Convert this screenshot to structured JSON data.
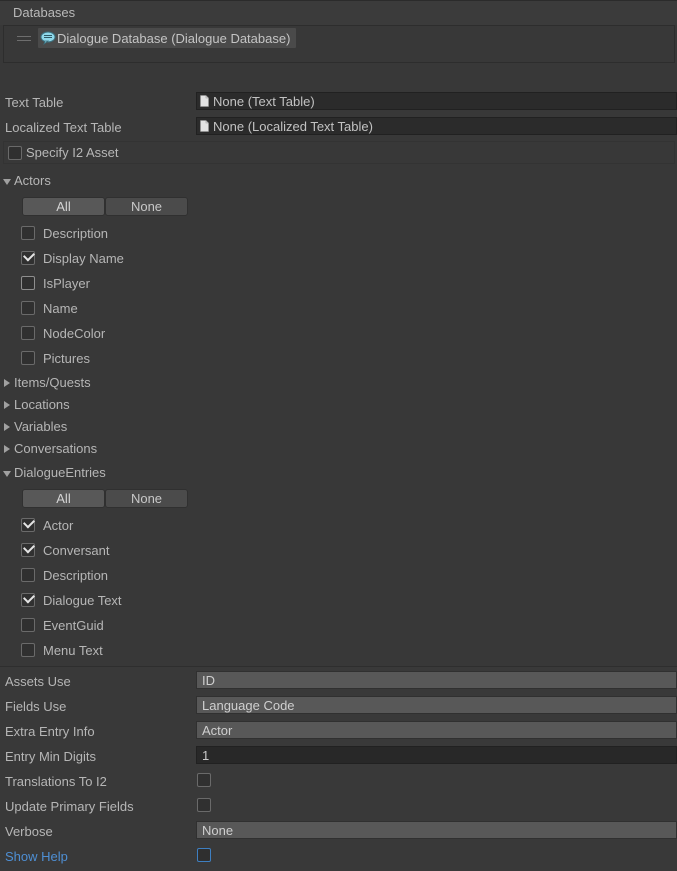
{
  "window": {
    "background": "#383838",
    "accent_blue": "#4e8fd4"
  },
  "databases_section": {
    "header_label": "Databases",
    "rows": [
      {
        "icon": "dialogue-bubble-icon",
        "label": "Dialogue Database (Dialogue Database)",
        "drag_handle": "drag-handle-icon"
      }
    ]
  },
  "text_tables": {
    "rows": [
      {
        "label": "Text Table",
        "value": "None (Text Table)",
        "icon": "document-icon"
      },
      {
        "label": "Localized Text Table",
        "value": "None (Localized Text Table)",
        "icon": "document-icon"
      }
    ],
    "specify_i2_asset": {
      "label": "Specify I2 Asset",
      "checked": false
    }
  },
  "sections": [
    {
      "name": "Actors",
      "label": "Actors",
      "expanded": true,
      "buttons": {
        "all": "All",
        "none": "None"
      },
      "fields": [
        {
          "label": "Description",
          "checked": false,
          "state": "normal"
        },
        {
          "label": "Display Name",
          "checked": true,
          "state": "normal"
        },
        {
          "label": "IsPlayer",
          "checked": false,
          "state": "hover"
        },
        {
          "label": "Name",
          "checked": false,
          "state": "normal"
        },
        {
          "label": "NodeColor",
          "checked": false,
          "state": "normal"
        },
        {
          "label": "Pictures",
          "checked": false,
          "state": "normal"
        }
      ]
    },
    {
      "name": "ItemsQuests",
      "label": "Items/Quests",
      "expanded": false
    },
    {
      "name": "Locations",
      "label": "Locations",
      "expanded": false
    },
    {
      "name": "Variables",
      "label": "Variables",
      "expanded": false
    },
    {
      "name": "Conversations",
      "label": "Conversations",
      "expanded": false
    },
    {
      "name": "DialogueEntries",
      "label": "DialogueEntries",
      "expanded": true,
      "buttons": {
        "all": "All",
        "none": "None"
      },
      "fields": [
        {
          "label": "Actor",
          "checked": true,
          "state": "normal"
        },
        {
          "label": "Conversant",
          "checked": true,
          "state": "normal"
        },
        {
          "label": "Description",
          "checked": false,
          "state": "normal"
        },
        {
          "label": "Dialogue Text",
          "checked": true,
          "state": "normal"
        },
        {
          "label": "EventGuid",
          "checked": false,
          "state": "normal"
        },
        {
          "label": "Menu Text",
          "checked": false,
          "state": "normal"
        }
      ]
    }
  ],
  "settings": {
    "rows": [
      {
        "label": "Assets Use",
        "type": "popup",
        "value": "ID"
      },
      {
        "label": "Fields Use",
        "type": "popup",
        "value": "Language Code"
      },
      {
        "label": "Extra Entry Info",
        "type": "popup",
        "value": "Actor"
      },
      {
        "label": "Entry Min Digits",
        "type": "number",
        "value": "1"
      },
      {
        "label": "Translations To I2",
        "type": "checkbox",
        "checked": false
      },
      {
        "label": "Update Primary Fields",
        "type": "checkbox",
        "checked": false
      },
      {
        "label": "Verbose",
        "type": "popup",
        "value": "None"
      },
      {
        "label": "Show Help",
        "type": "checkbox",
        "checked": false,
        "link": true
      }
    ]
  }
}
